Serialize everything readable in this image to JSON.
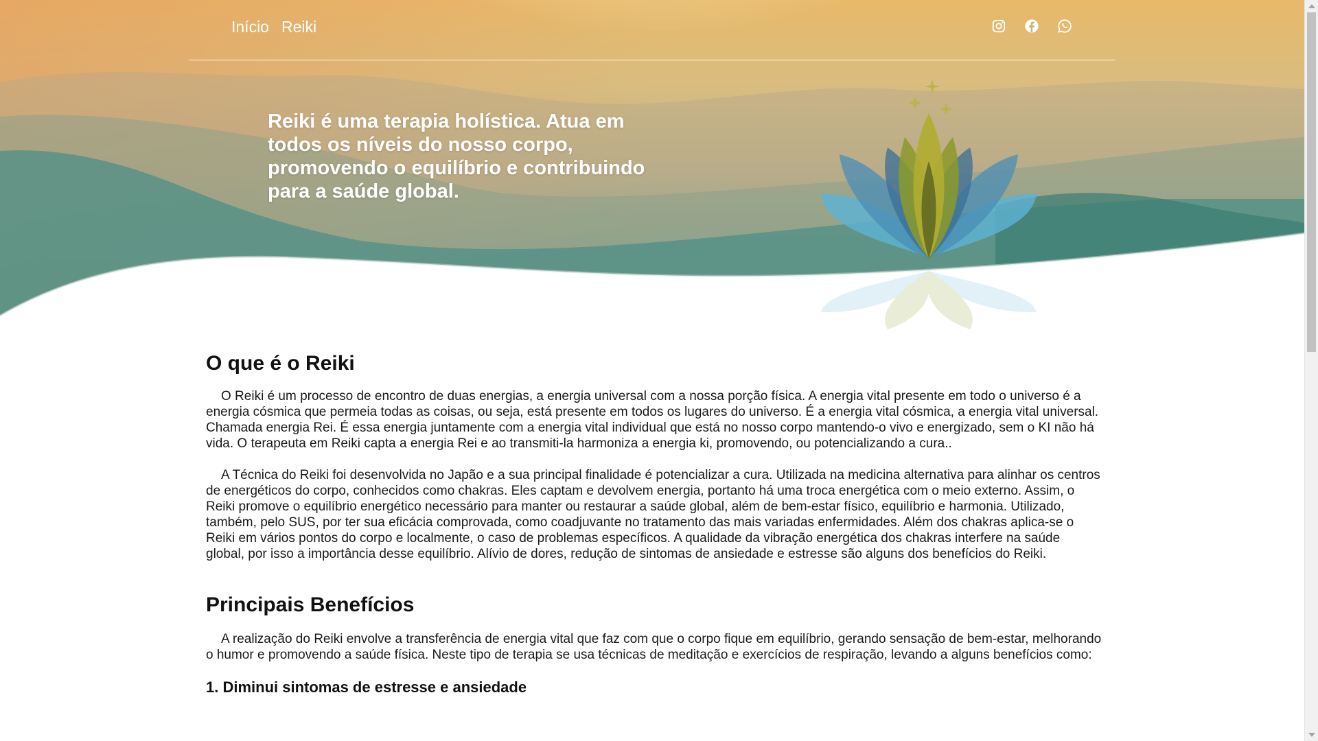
{
  "nav": {
    "links": [
      "Início",
      "Reiki"
    ],
    "social_icons": [
      "instagram-icon",
      "facebook-icon",
      "whatsapp-icon"
    ]
  },
  "hero": {
    "tagline": "Reiki é uma terapia holística. Atua em todos os níveis do nosso corpo, promovendo o equilíbrio e contribuindo para a saúde global.",
    "image": "lotus-icon"
  },
  "sections": {
    "what_is": {
      "title": "O que é o Reiki",
      "paragraphs": [
        "O Reiki é um processo de encontro de duas energias, a energia universal com a nossa porção física. A energia vital presente em todo o universo é a energia cósmica que permeia todas as coisas, ou seja, está presente em todos os lugares do universo. É a energia vital cósmica, a energia vital universal. Chamada energia Rei. É essa energia juntamente com a energia vital individual que está no nosso corpo mantendo-o vivo e energizado, sem o KI não há vida. O terapeuta em Reiki capta a energia Rei e ao transmiti-la harmoniza a energia ki, promovendo, ou potencializando a cura..",
        "A Técnica do Reiki foi desenvolvida no Japão e a sua principal finalidade é potencializar a cura. Utilizada na medicina alternativa para alinhar os centros de energéticos do corpo, conhecidos como chakras. Eles captam e devolvem energia, portanto há uma troca energética com o meio externo. Assim, o Reiki promove o equilíbrio energético necessário para manter ou restaurar a saúde global, além de bem-estar físico, equilíbrio e harmonia. Utilizado, também, pelo SUS, por ter sua eficácia comprovada, como coadjuvante no tratamento das mais variadas enfermidades. Além dos chakras aplica-se o Reiki em vários pontos do corpo e localmente, o caso de problemas específicos. A qualidade da vibração energética dos chakras interfere na saúde global, por isso a importância desse equilíbrio. Alívio de dores, redução de sintomas de ansiedade e estresse são alguns dos benefícios do Reiki."
      ]
    },
    "benefits": {
      "title": "Principais Benefícios",
      "intro": "A realização do Reiki envolve a transferência de energia vital que faz com que o corpo fique em equilíbrio, gerando sensação de bem-estar, melhorando o humor e promovendo a saúde física. Neste tipo de terapia se usa técnicas de meditação e exercícios de respiração, levando a alguns benefícios como:",
      "first_item": "1. Diminui sintomas de estresse e ansiedade"
    }
  },
  "colors": {
    "sky_top": "#e2bc6c",
    "sky_mid": "#c9b98a",
    "hill_teal": "#3f8a84",
    "lotus_green": "#a8ae2c",
    "lotus_blue": "#4aa6c9"
  }
}
